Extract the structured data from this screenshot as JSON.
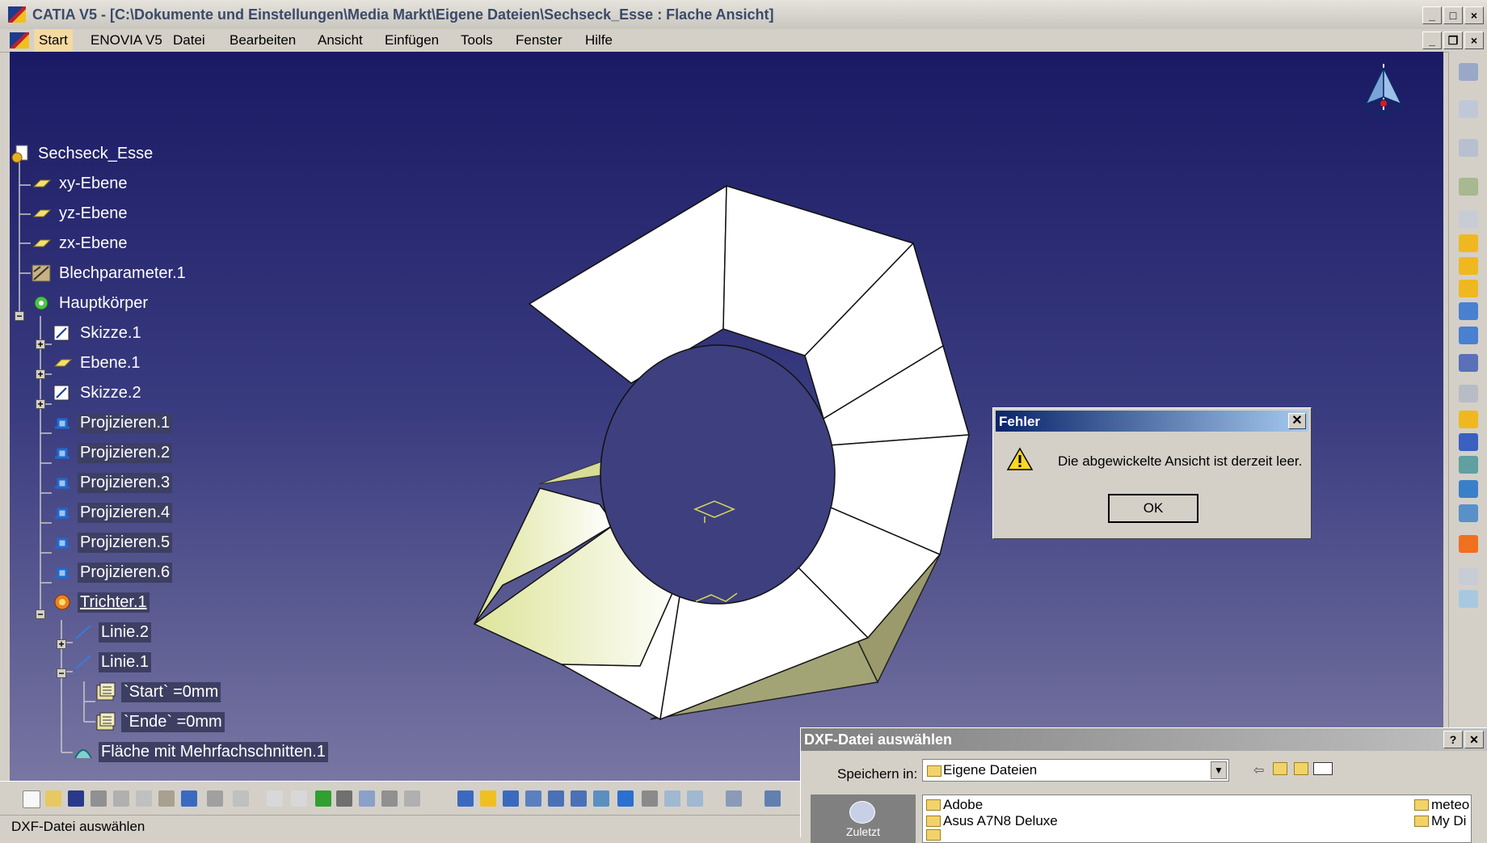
{
  "window": {
    "title": "CATIA V5 - [C:\\Dokumente und Einstellungen\\Media Markt\\Eigene Dateien\\Sechseck_Esse : Flache Ansicht]"
  },
  "menu": [
    "Start",
    "ENOVIA V5",
    "Datei",
    "Bearbeiten",
    "Ansicht",
    "Einfügen",
    "Tools",
    "Fenster",
    "Hilfe"
  ],
  "tree": [
    {
      "label": "Sechseck_Esse"
    },
    {
      "label": "xy-Ebene"
    },
    {
      "label": "yz-Ebene"
    },
    {
      "label": "zx-Ebene"
    },
    {
      "label": "Blechparameter.1"
    },
    {
      "label": "Hauptkörper"
    },
    {
      "label": "Skizze.1"
    },
    {
      "label": "Ebene.1"
    },
    {
      "label": "Skizze.2"
    },
    {
      "label": "Projizieren.1"
    },
    {
      "label": "Projizieren.2"
    },
    {
      "label": "Projizieren.3"
    },
    {
      "label": "Projizieren.4"
    },
    {
      "label": "Projizieren.5"
    },
    {
      "label": "Projizieren.6"
    },
    {
      "label": "Trichter.1"
    },
    {
      "label": "Linie.2"
    },
    {
      "label": "Linie.1"
    },
    {
      "label": "`Start` =0mm"
    },
    {
      "label": "`Ende` =0mm"
    },
    {
      "label": "Fläche mit Mehrfachschnitten.1"
    }
  ],
  "error_dialog": {
    "title": "Fehler",
    "message": "Die abgewickelte Ansicht ist derzeit leer.",
    "ok_label": "OK",
    "close_glyph": "✕"
  },
  "file_dialog": {
    "title": "DXF-Datei auswählen",
    "save_in_label": "Speichern in:",
    "location": "Eigene Dateien",
    "places_label": "Zuletzt",
    "items": [
      "Adobe",
      "Asus A7N8 Deluxe",
      "meteo",
      "My Di"
    ],
    "help_glyph": "?",
    "close_glyph": "✕"
  },
  "status": {
    "text": "DXF-Datei auswählen"
  },
  "colors": {
    "viewport_top": "#1a1a64",
    "viewport_bottom": "#7876a2",
    "tree_highlight": "#3d3f62",
    "dialog_title": "#0a246a",
    "face_white": "#ffffff",
    "face_yellow": "#eef0b8",
    "face_olive": "#9a9a6c"
  },
  "icons": [
    "app-logo-icon",
    "compass-icon",
    "warning-icon",
    "folder-icon",
    "part-icon",
    "plane-icon",
    "sketch-icon",
    "body-icon",
    "projection-icon",
    "funnel-icon",
    "line-icon",
    "parameter-icon",
    "loft-icon"
  ]
}
